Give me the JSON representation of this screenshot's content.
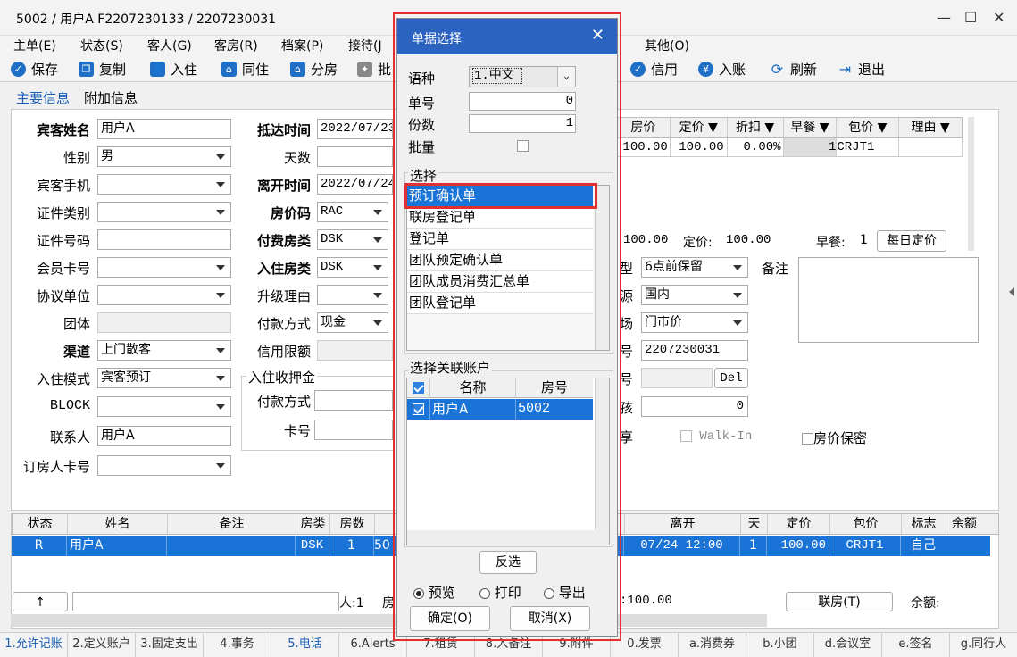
{
  "window": {
    "title": "5002 / 用户A F2207230133 / 2207230031"
  },
  "menu": [
    "主单(E)",
    "状态(S)",
    "客人(G)",
    "客房(R)",
    "档案(P)",
    "接待(J",
    "其他(O)"
  ],
  "toolbar": {
    "save": "保存",
    "copy": "复制",
    "checkin": "入住",
    "share": "同住",
    "split": "分房",
    "batch": "批",
    "credit": "信用",
    "post": "入账",
    "refresh": "刷新",
    "exit": "退出"
  },
  "tabs": {
    "main": "主要信息",
    "extra": "附加信息"
  },
  "form": {
    "guest_name_label": "宾客姓名",
    "guest_name": "用户A",
    "gender_label": "性别",
    "gender": "男",
    "mobile_label": "宾客手机",
    "id_type_label": "证件类别",
    "id_no_label": "证件号码",
    "member_label": "会员卡号",
    "agreement_label": "协议单位",
    "group_label": "团体",
    "channel_label": "渠道",
    "channel": "上门散客",
    "mode_label": "入住模式",
    "mode": "宾客预订",
    "block_label": "BLOCK",
    "contact_label": "联系人",
    "contact": "用户A",
    "booker_label": "订房人卡号",
    "arrival_label": "抵达时间",
    "arrival": "2022/07/23",
    "days_label": "天数",
    "departure_label": "离开时间",
    "departure": "2022/07/24",
    "rate_code_label": "房价码",
    "rate_code": "RAC",
    "pay_room_label": "付费房类",
    "pay_room": "DSK",
    "stay_room_label": "入住房类",
    "stay_room": "DSK",
    "upgrade_label": "升级理由",
    "pay_method_label": "付款方式",
    "pay_method": "现金",
    "credit_limit_label": "信用限额",
    "deposit_group": "入住收押金",
    "deposit_pay_label": "付款方式",
    "card_label": "卡号"
  },
  "rate_grid": {
    "headers": [
      "房价",
      "定价 ▼",
      "折扣 ▼",
      "早餐 ▼",
      "包价 ▼",
      "理由 ▼"
    ],
    "row": [
      "100.00",
      "100.00",
      "0.00%",
      "1",
      "CRJT1",
      ""
    ]
  },
  "summary": {
    "rate": "100.00",
    "fixed_label": "定价:",
    "fixed": "100.00",
    "breakfast_label": "早餐:",
    "breakfast": "1",
    "daily_btn": "每日定价"
  },
  "right_form": {
    "type_label": "型",
    "type": "6点前保留",
    "source_label": "源",
    "source": "国内",
    "market_label": "场",
    "market": "门市价",
    "no_label": "号",
    "no": "2207230031",
    "no2_label": "号",
    "del_btn": "Del",
    "child_label": "孩",
    "child": "0",
    "share_label": "享",
    "walkin": "Walk-In",
    "secret": "房价保密",
    "remark_label": "备注"
  },
  "bottom_grid": {
    "headers": [
      "状态",
      "姓名",
      "备注",
      "房类",
      "房数",
      "离开",
      "天",
      "定价",
      "包价",
      "标志",
      "余额"
    ],
    "row": [
      "R",
      "用户A",
      "",
      "DSK",
      "1",
      "50",
      "07/24 12:00",
      "1",
      "100.00",
      "CRJT1",
      "自己"
    ]
  },
  "bottom_bar": {
    "up": "↑",
    "count": "人:1",
    "room": "房",
    "amount": ":100.00",
    "link_btn": "联房(T)",
    "balance_label": "余额:"
  },
  "statusbar": [
    "1.允许记账",
    "2.定义账户",
    "3.固定支出",
    "4.事务",
    "5.电话",
    "6.Alerts",
    "7.租赁",
    "8.入备注",
    "9.附件",
    "0.发票",
    "a.消费券",
    "b.小团",
    "d.会议室",
    "e.签名",
    "g.同行人"
  ],
  "dialog": {
    "title": "单据选择",
    "lang_label": "语种",
    "lang": "1.中文",
    "no_label": "单号",
    "no": "0",
    "copies_label": "份数",
    "copies": "1",
    "batch_label": "批量",
    "choose_label": "选择",
    "items": [
      "预订确认单",
      "联房登记单",
      "登记单",
      "团队预定确认单",
      "团队成员消费汇总单",
      "团队登记单"
    ],
    "linked_label": "选择关联账户",
    "acc_headers": [
      "名称",
      "房号"
    ],
    "acc_row": [
      "用户A",
      "5002"
    ],
    "invert_btn": "反选",
    "preview": "预览",
    "print": "打印",
    "export": "导出",
    "ok_btn": "确定(O)",
    "cancel_btn": "取消(X)"
  }
}
